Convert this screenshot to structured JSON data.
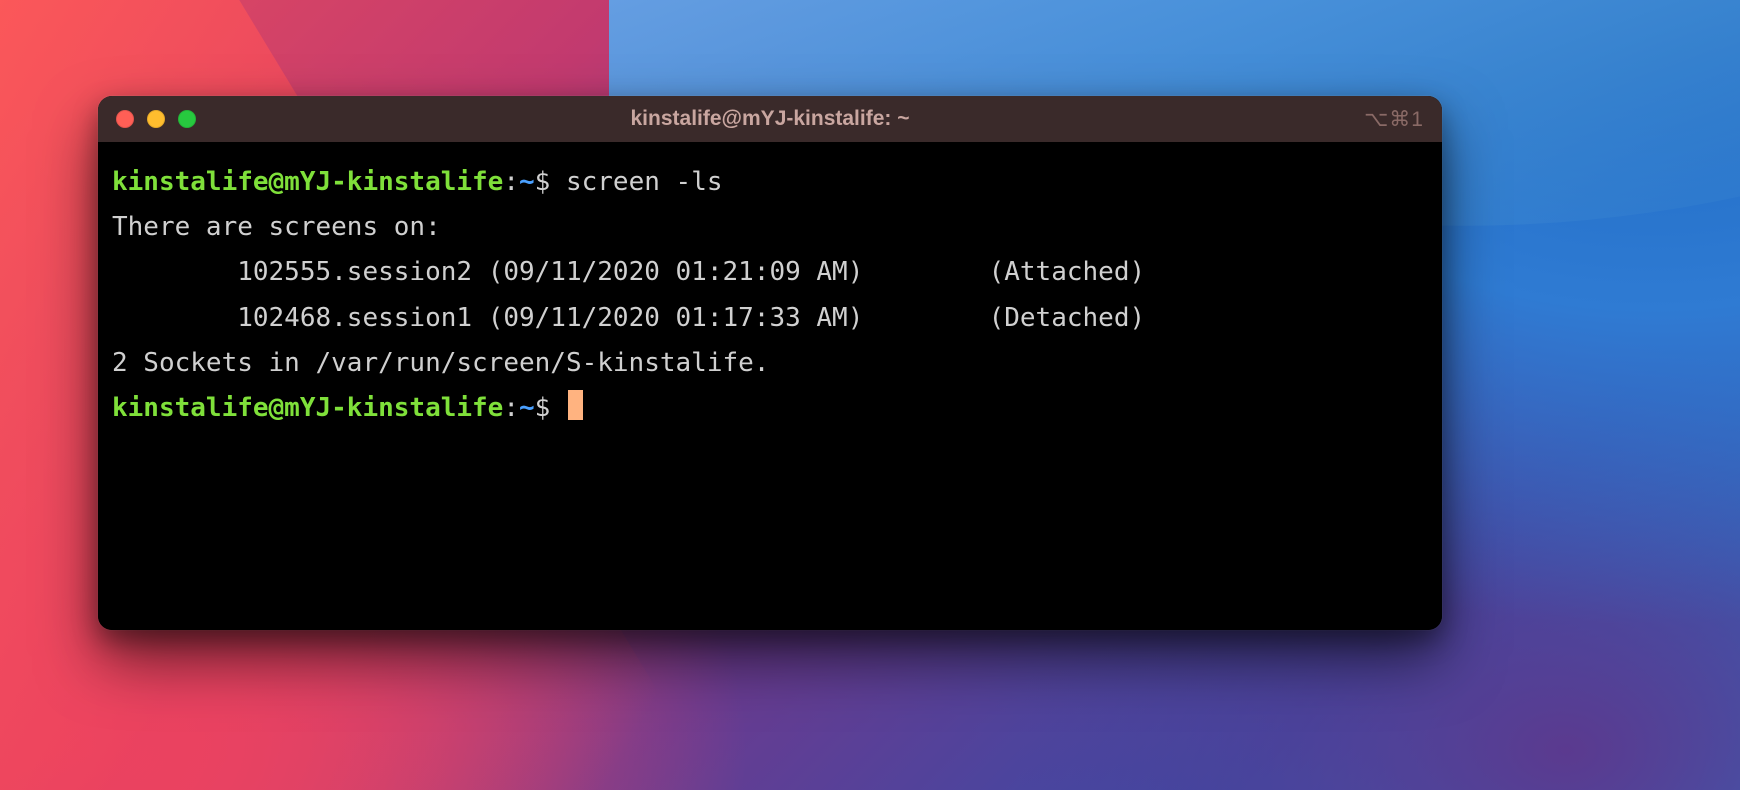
{
  "window": {
    "title": "kinstalife@mYJ-kinstalife: ~",
    "tab_hint": "⌥⌘1"
  },
  "prompt": {
    "user_host": "kinstalife@mYJ-kinstalife",
    "separator": ":",
    "path": "~",
    "symbol": "$"
  },
  "lines": {
    "cmd1": "screen -ls",
    "out_header": "There are screens on:",
    "session1": "        102555.session2\t(09/11/2020 01:21:09 AM)\t(Attached)",
    "session2": "        102468.session1\t(09/11/2020 01:17:33 AM)\t(Detached)",
    "sockets": "2 Sockets in /var/run/screen/S-kinstalife."
  }
}
